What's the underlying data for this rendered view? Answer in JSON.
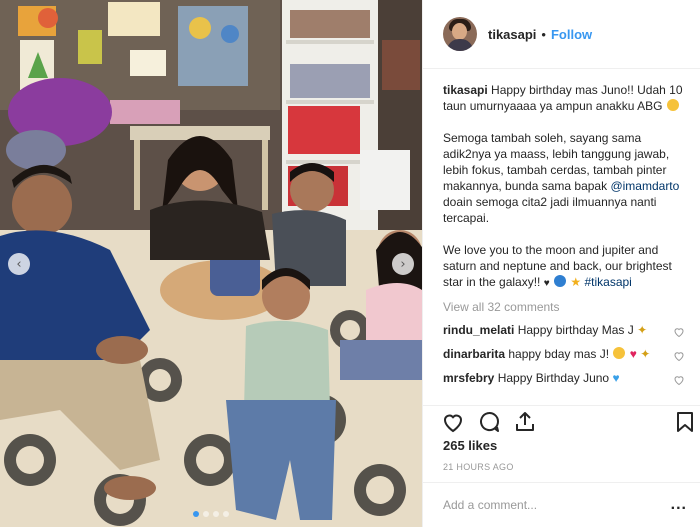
{
  "header": {
    "username": "tikasapi",
    "separator": "•",
    "follow_label": "Follow"
  },
  "caption": {
    "username": "tikasapi",
    "line1": "Happy birthday mas Juno!! Udah 10 taun umurnyaaaa ya ampun anakku ABG",
    "line2_pre": "Semoga tambah soleh, sayang sama adik2nya ya maass, lebih tanggung jawab, lebih fokus, tambah cerdas, tambah pinter makannya, bunda sama bapak",
    "mention": "@imamdarto",
    "line2_post": "doain semoga cita2 jadi ilmuannya nanti tercapai.",
    "line3": "We love you to the moon and jupiter and saturn and neptune and back, our brightest star in the galaxy!!",
    "hashtag": "#tikasapi"
  },
  "view_all": "View all 32 comments",
  "comments": [
    {
      "user": "rindu_melati",
      "text": "Happy birthday Mas J"
    },
    {
      "user": "dinarbarita",
      "text": "happy bday mas J!"
    },
    {
      "user": "mrsfebry",
      "text": "Happy Birthday Juno"
    }
  ],
  "likes": "265 likes",
  "time": "21 HOURS AGO",
  "add_comment_placeholder": "Add a comment...",
  "more_label": "...",
  "icons": {
    "like": "heart-icon",
    "comment": "comment-icon",
    "share": "share-icon",
    "save": "bookmark-icon",
    "nav_prev": "chevron-left-icon",
    "nav_next": "chevron-right-icon"
  },
  "nav_glyphs": {
    "prev": "‹",
    "next": "›"
  },
  "carousel": {
    "count": 4,
    "active": 1
  },
  "colors": {
    "accent": "#3897f0",
    "link": "#003569",
    "muted": "#999999",
    "border": "#efefef"
  }
}
